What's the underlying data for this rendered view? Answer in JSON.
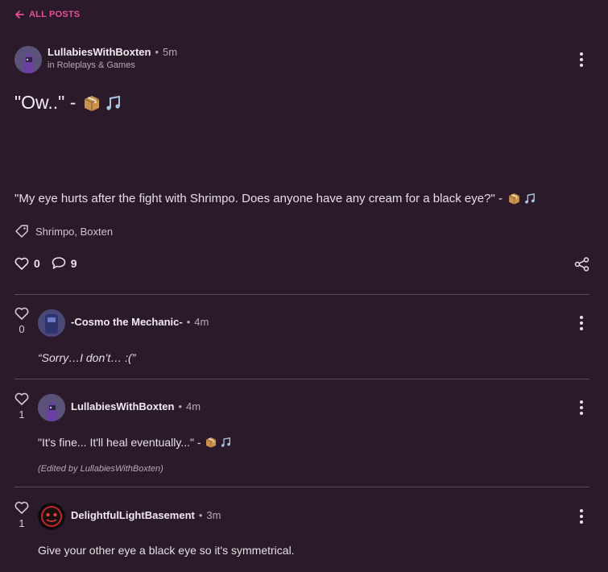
{
  "nav": {
    "back_label": "ALL POSTS"
  },
  "post": {
    "author": "LullabiesWithBoxten",
    "time": "5m",
    "category_line": "in Roleplays & Games",
    "title": "\"Ow..\" -",
    "body": "\"My eye hurts after the fight with Shrimpo. Does anyone have any cream for a black eye?\" -",
    "tags": "Shrimpo, Boxten",
    "likes": "0",
    "comments": "9",
    "emoji_icons": [
      "package-icon",
      "music-note-icon"
    ]
  },
  "comments": [
    {
      "likes": "0",
      "author": "-Cosmo the Mechanic-",
      "time": "4m",
      "text": "“Sorry…I don’t… :(”"
    },
    {
      "likes": "1",
      "author": "LullabiesWithBoxten",
      "time": "4m",
      "text": "\"It's fine... It'll heal eventually...\" -",
      "edited": "(Edited by LullabiesWithBoxten)"
    },
    {
      "likes": "1",
      "author": "DelightfulLightBasement",
      "time": "3m",
      "text": "Give your other eye a black eye so it's symmetrical."
    }
  ],
  "colors": {
    "background": "#2b1a29",
    "accent": "#e6509a",
    "divider": "#5c4a58"
  }
}
